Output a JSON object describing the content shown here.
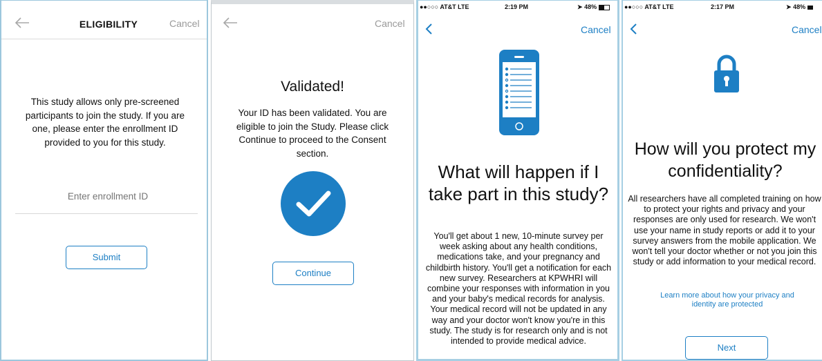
{
  "screen1": {
    "back_icon": "arrow-left-icon",
    "title": "ELIGIBILITY",
    "cancel": "Cancel",
    "body": "This study allows only pre-screened participants to join the study. If you are one, please enter the enrollment ID provided to you for this study.",
    "input_placeholder": "Enter enrollment ID",
    "submit": "Submit"
  },
  "screen2": {
    "back_icon": "arrow-left-icon",
    "cancel": "Cancel",
    "heading": "Validated!",
    "body": "Your ID has been validated. You are eligible to join the Study. Please click Continue to proceed to the Consent section.",
    "check_icon": "checkmark-circle-icon",
    "continue": "Continue"
  },
  "screen3": {
    "status": {
      "carrier": "●●○○○ AT&T  LTE",
      "time": "2:19 PM",
      "battery": "48%"
    },
    "back_icon": "chevron-left-icon",
    "cancel": "Cancel",
    "illustration_icon": "phone-checklist-icon",
    "heading": "What will happen if I take part in this study?",
    "body": "You'll get about 1 new, 10-minute survey per week asking about any health conditions, medications take, and your pregnancy and childbirth history. You'll get a notification for each new survey. Researchers at KPWHRI will combine your responses with information in you and your baby's medical records for analysis. Your medical record will not be updated in any way and your doctor won't know you're in this study. The study is for research only and is not intended to provide medical advice."
  },
  "screen4": {
    "status": {
      "carrier": "●●○○○ AT&T  LTE",
      "time": "2:17 PM",
      "battery": "48%"
    },
    "back_icon": "chevron-left-icon",
    "cancel": "Cancel",
    "lock_icon": "lock-icon",
    "heading": "How will you protect my confidentiality?",
    "body": "All researchers have all completed training on how to protect your rights and privacy and your responses are only used for research. We won't use your name in study reports or add it to your survey answers from the mobile application. We won't tell your doctor whether or not you join this study or add information to your medical record.",
    "link": "Learn more about how your privacy and identity are protected",
    "next": "Next"
  },
  "colors": {
    "accent": "#1d7fc4",
    "muted": "#9a9a9a"
  }
}
